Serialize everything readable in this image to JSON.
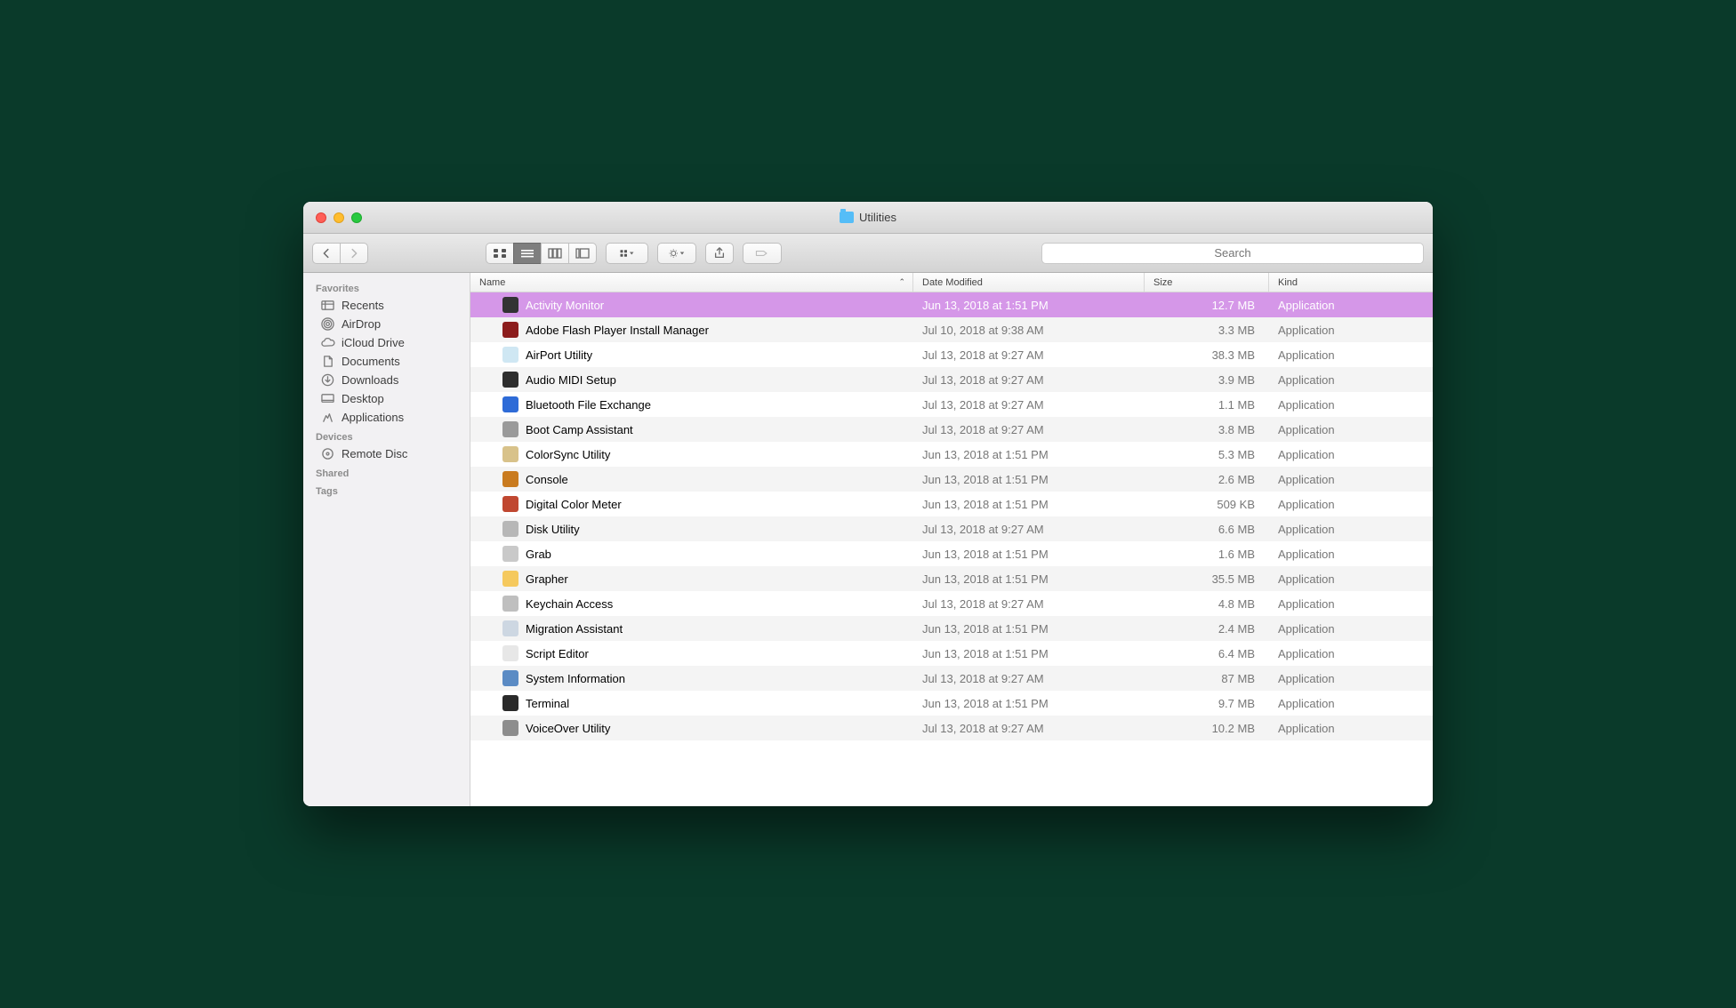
{
  "window": {
    "title": "Utilities"
  },
  "search": {
    "placeholder": "Search"
  },
  "sidebar": {
    "sections": [
      {
        "heading": "Favorites",
        "items": [
          {
            "label": "Recents",
            "icon": "recents-icon"
          },
          {
            "label": "AirDrop",
            "icon": "airdrop-icon"
          },
          {
            "label": "iCloud Drive",
            "icon": "icloud-icon"
          },
          {
            "label": "Documents",
            "icon": "documents-icon"
          },
          {
            "label": "Downloads",
            "icon": "downloads-icon"
          },
          {
            "label": "Desktop",
            "icon": "desktop-icon"
          },
          {
            "label": "Applications",
            "icon": "applications-icon"
          }
        ]
      },
      {
        "heading": "Devices",
        "items": [
          {
            "label": "Remote Disc",
            "icon": "remote-disc-icon"
          }
        ]
      },
      {
        "heading": "Shared",
        "items": []
      },
      {
        "heading": "Tags",
        "items": []
      }
    ]
  },
  "columns": {
    "name": "Name",
    "date": "Date Modified",
    "size": "Size",
    "kind": "Kind"
  },
  "files": [
    {
      "name": "Activity Monitor",
      "date": "Jun 13, 2018 at 1:51 PM",
      "size": "12.7 MB",
      "kind": "Application",
      "ic": "#333",
      "selected": true
    },
    {
      "name": "Adobe Flash Player Install Manager",
      "date": "Jul 10, 2018 at 9:38 AM",
      "size": "3.3 MB",
      "kind": "Application",
      "ic": "#8c1d1d"
    },
    {
      "name": "AirPort Utility",
      "date": "Jul 13, 2018 at 9:27 AM",
      "size": "38.3 MB",
      "kind": "Application",
      "ic": "#cfe7f3"
    },
    {
      "name": "Audio MIDI Setup",
      "date": "Jul 13, 2018 at 9:27 AM",
      "size": "3.9 MB",
      "kind": "Application",
      "ic": "#2e2e2e"
    },
    {
      "name": "Bluetooth File Exchange",
      "date": "Jul 13, 2018 at 9:27 AM",
      "size": "1.1 MB",
      "kind": "Application",
      "ic": "#2e6bd7"
    },
    {
      "name": "Boot Camp Assistant",
      "date": "Jul 13, 2018 at 9:27 AM",
      "size": "3.8 MB",
      "kind": "Application",
      "ic": "#9a9a9a"
    },
    {
      "name": "ColorSync Utility",
      "date": "Jun 13, 2018 at 1:51 PM",
      "size": "5.3 MB",
      "kind": "Application",
      "ic": "#d8c28a"
    },
    {
      "name": "Console",
      "date": "Jun 13, 2018 at 1:51 PM",
      "size": "2.6 MB",
      "kind": "Application",
      "ic": "#c97b1f"
    },
    {
      "name": "Digital Color Meter",
      "date": "Jun 13, 2018 at 1:51 PM",
      "size": "509 KB",
      "kind": "Application",
      "ic": "#c04730"
    },
    {
      "name": "Disk Utility",
      "date": "Jul 13, 2018 at 9:27 AM",
      "size": "6.6 MB",
      "kind": "Application",
      "ic": "#b7b7b7"
    },
    {
      "name": "Grab",
      "date": "Jun 13, 2018 at 1:51 PM",
      "size": "1.6 MB",
      "kind": "Application",
      "ic": "#c9c9c9"
    },
    {
      "name": "Grapher",
      "date": "Jun 13, 2018 at 1:51 PM",
      "size": "35.5 MB",
      "kind": "Application",
      "ic": "#f5c95e"
    },
    {
      "name": "Keychain Access",
      "date": "Jul 13, 2018 at 9:27 AM",
      "size": "4.8 MB",
      "kind": "Application",
      "ic": "#bfbfbf"
    },
    {
      "name": "Migration Assistant",
      "date": "Jun 13, 2018 at 1:51 PM",
      "size": "2.4 MB",
      "kind": "Application",
      "ic": "#cdd7e2"
    },
    {
      "name": "Script Editor",
      "date": "Jun 13, 2018 at 1:51 PM",
      "size": "6.4 MB",
      "kind": "Application",
      "ic": "#e7e7e7"
    },
    {
      "name": "System Information",
      "date": "Jul 13, 2018 at 9:27 AM",
      "size": "87 MB",
      "kind": "Application",
      "ic": "#5b8bc4"
    },
    {
      "name": "Terminal",
      "date": "Jun 13, 2018 at 1:51 PM",
      "size": "9.7 MB",
      "kind": "Application",
      "ic": "#2a2a2a"
    },
    {
      "name": "VoiceOver Utility",
      "date": "Jul 13, 2018 at 9:27 AM",
      "size": "10.2 MB",
      "kind": "Application",
      "ic": "#8d8d8d"
    }
  ]
}
